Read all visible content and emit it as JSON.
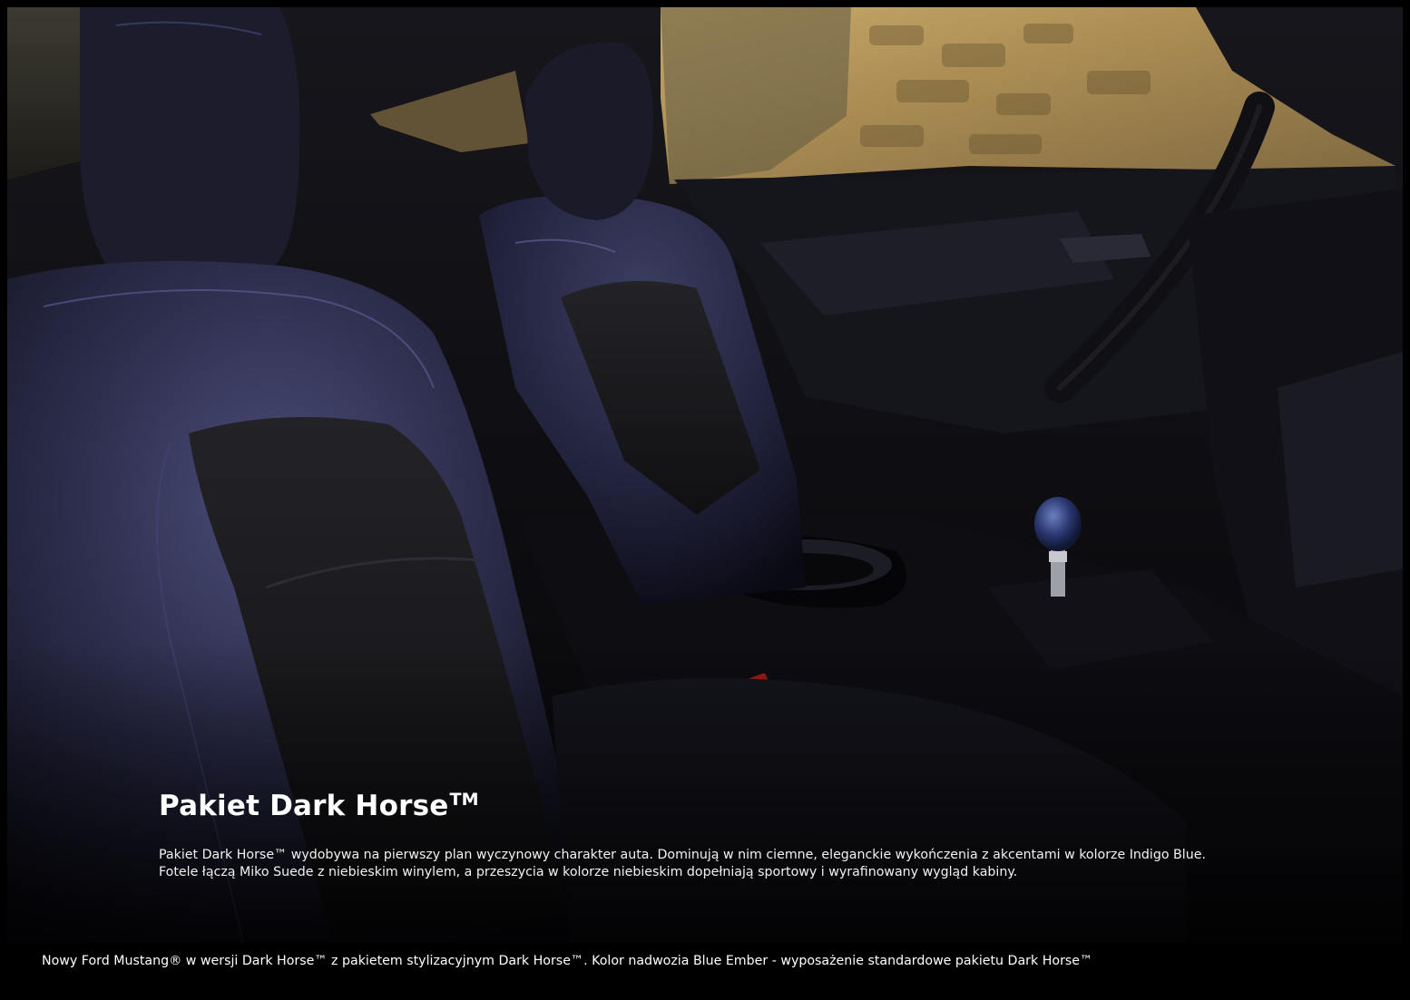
{
  "hero": {
    "title": "Pakiet Dark Horse",
    "title_mark": "TM",
    "description_lines": [
      "Pakiet Dark Horse™ wydobywa na pierwszy plan wyczynowy charakter auta. Dominują w nim ciemne, eleganckie wykończenia z akcentami w kolorze Indigo Blue.",
      "Fotele łączą Miko Suede z niebieskim winylem, a przeszycia w kolorze niebieskim dopełniają sportowy i wyrafinowany wygląd kabiny."
    ]
  },
  "footer": {
    "disclaimer": "Nowy Ford Mustang® w wersji Dark Horse™ z pakietem stylizacyjnym Dark Horse™. Kolor nadwozia Blue Ember - wyposażenie standardowe pakietu Dark Horse™"
  },
  "colors": {
    "background": "#000000",
    "text": "#ffffff",
    "accent_indigo": "#2b3563",
    "stone_wall": "#b59a5e"
  }
}
